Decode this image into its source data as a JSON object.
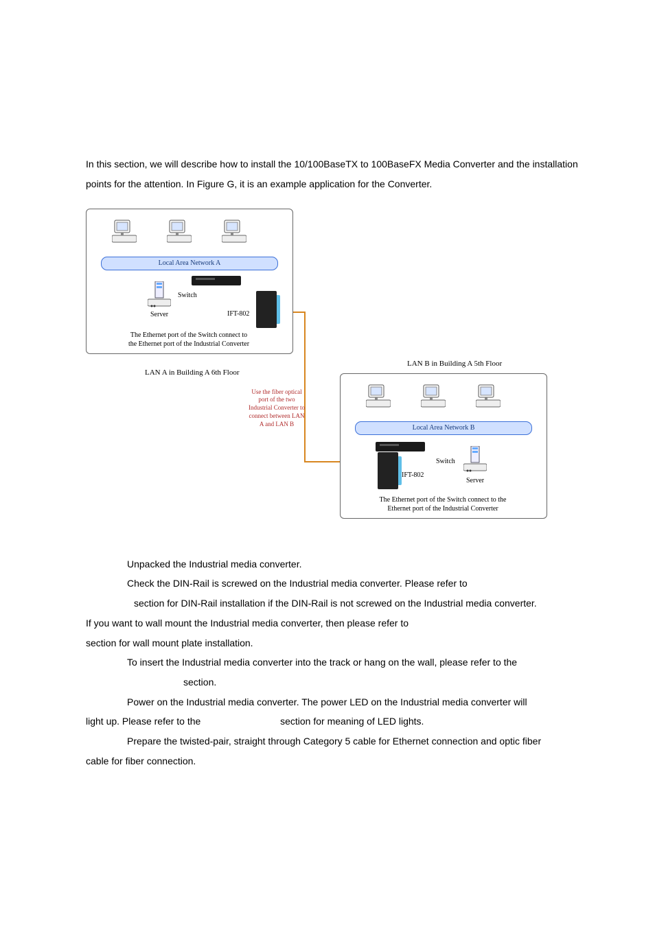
{
  "intro": "In this section, we will describe how to install the 10/100BaseTX to 100BaseFX Media Converter and the installation points for the attention. In Figure G, it is an example application for the Converter.",
  "diagram": {
    "lan_a_bar": "Local Area Network A",
    "lan_b_bar": "Local Area Network B",
    "switch_label": "Switch",
    "ift_label": "IFT-802",
    "server_label": "Server",
    "box_a_caption_l1": "The Ethernet port of the Switch connect to",
    "box_a_caption_l2": "the Ethernet port of the Industrial Converter",
    "box_b_caption_l1": "The Ethernet port of the Switch connect to the",
    "box_b_caption_l2": "Ethernet port of the Industrial Converter",
    "lan_a_caption": "LAN A in Building A 6th Floor",
    "lan_b_caption": "LAN B in Building A 5th Floor",
    "fiber_l1": "Use the fiber optical",
    "fiber_l2": "port of the two",
    "fiber_l3": "Industrial Converter to",
    "fiber_l4": "connect between LAN",
    "fiber_l5": "A and LAN B"
  },
  "s1": "Unpacked the Industrial media converter.",
  "s2": "Check the DIN-Rail is screwed on the Industrial media converter. Please refer to",
  "s2b": "section for DIN-Rail installation if the DIN-Rail is not screwed on the Industrial media converter.",
  "s2c": "If you want to wall mount the Industrial media converter, then please refer to",
  "s2d": "section for wall mount plate installation.",
  "s3": "To insert the Industrial media converter into the track or hang on the wall, please refer to the",
  "s3b": "section.",
  "s4": "Power on the Industrial media converter. The power LED on the Industrial media converter will",
  "s4b_a": "light up. Please refer to the",
  "s4b_b": "section for meaning of LED lights.",
  "s5": "Prepare the twisted-pair, straight through Category 5 cable for Ethernet connection and optic fiber",
  "s5b": "cable for fiber connection."
}
